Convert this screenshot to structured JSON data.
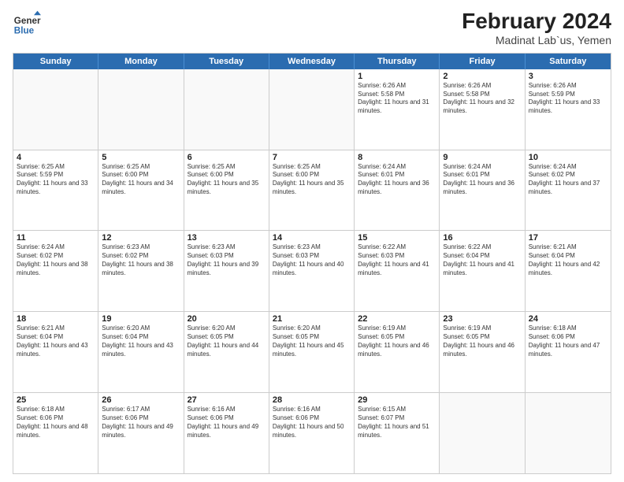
{
  "header": {
    "logo": {
      "line1": "General",
      "line2": "Blue"
    },
    "title": "February 2024",
    "subtitle": "Madinat Lab`us, Yemen"
  },
  "weekdays": [
    "Sunday",
    "Monday",
    "Tuesday",
    "Wednesday",
    "Thursday",
    "Friday",
    "Saturday"
  ],
  "rows": [
    [
      {
        "day": "",
        "empty": true
      },
      {
        "day": "",
        "empty": true
      },
      {
        "day": "",
        "empty": true
      },
      {
        "day": "",
        "empty": true
      },
      {
        "day": "1",
        "sunrise": "6:26 AM",
        "sunset": "5:58 PM",
        "daylight": "11 hours and 31 minutes."
      },
      {
        "day": "2",
        "sunrise": "6:26 AM",
        "sunset": "5:58 PM",
        "daylight": "11 hours and 32 minutes."
      },
      {
        "day": "3",
        "sunrise": "6:26 AM",
        "sunset": "5:59 PM",
        "daylight": "11 hours and 33 minutes."
      }
    ],
    [
      {
        "day": "4",
        "sunrise": "6:25 AM",
        "sunset": "5:59 PM",
        "daylight": "11 hours and 33 minutes."
      },
      {
        "day": "5",
        "sunrise": "6:25 AM",
        "sunset": "6:00 PM",
        "daylight": "11 hours and 34 minutes."
      },
      {
        "day": "6",
        "sunrise": "6:25 AM",
        "sunset": "6:00 PM",
        "daylight": "11 hours and 35 minutes."
      },
      {
        "day": "7",
        "sunrise": "6:25 AM",
        "sunset": "6:00 PM",
        "daylight": "11 hours and 35 minutes."
      },
      {
        "day": "8",
        "sunrise": "6:24 AM",
        "sunset": "6:01 PM",
        "daylight": "11 hours and 36 minutes."
      },
      {
        "day": "9",
        "sunrise": "6:24 AM",
        "sunset": "6:01 PM",
        "daylight": "11 hours and 36 minutes."
      },
      {
        "day": "10",
        "sunrise": "6:24 AM",
        "sunset": "6:02 PM",
        "daylight": "11 hours and 37 minutes."
      }
    ],
    [
      {
        "day": "11",
        "sunrise": "6:24 AM",
        "sunset": "6:02 PM",
        "daylight": "11 hours and 38 minutes."
      },
      {
        "day": "12",
        "sunrise": "6:23 AM",
        "sunset": "6:02 PM",
        "daylight": "11 hours and 38 minutes."
      },
      {
        "day": "13",
        "sunrise": "6:23 AM",
        "sunset": "6:03 PM",
        "daylight": "11 hours and 39 minutes."
      },
      {
        "day": "14",
        "sunrise": "6:23 AM",
        "sunset": "6:03 PM",
        "daylight": "11 hours and 40 minutes."
      },
      {
        "day": "15",
        "sunrise": "6:22 AM",
        "sunset": "6:03 PM",
        "daylight": "11 hours and 41 minutes."
      },
      {
        "day": "16",
        "sunrise": "6:22 AM",
        "sunset": "6:04 PM",
        "daylight": "11 hours and 41 minutes."
      },
      {
        "day": "17",
        "sunrise": "6:21 AM",
        "sunset": "6:04 PM",
        "daylight": "11 hours and 42 minutes."
      }
    ],
    [
      {
        "day": "18",
        "sunrise": "6:21 AM",
        "sunset": "6:04 PM",
        "daylight": "11 hours and 43 minutes."
      },
      {
        "day": "19",
        "sunrise": "6:20 AM",
        "sunset": "6:04 PM",
        "daylight": "11 hours and 43 minutes."
      },
      {
        "day": "20",
        "sunrise": "6:20 AM",
        "sunset": "6:05 PM",
        "daylight": "11 hours and 44 minutes."
      },
      {
        "day": "21",
        "sunrise": "6:20 AM",
        "sunset": "6:05 PM",
        "daylight": "11 hours and 45 minutes."
      },
      {
        "day": "22",
        "sunrise": "6:19 AM",
        "sunset": "6:05 PM",
        "daylight": "11 hours and 46 minutes."
      },
      {
        "day": "23",
        "sunrise": "6:19 AM",
        "sunset": "6:05 PM",
        "daylight": "11 hours and 46 minutes."
      },
      {
        "day": "24",
        "sunrise": "6:18 AM",
        "sunset": "6:06 PM",
        "daylight": "11 hours and 47 minutes."
      }
    ],
    [
      {
        "day": "25",
        "sunrise": "6:18 AM",
        "sunset": "6:06 PM",
        "daylight": "11 hours and 48 minutes."
      },
      {
        "day": "26",
        "sunrise": "6:17 AM",
        "sunset": "6:06 PM",
        "daylight": "11 hours and 49 minutes."
      },
      {
        "day": "27",
        "sunrise": "6:16 AM",
        "sunset": "6:06 PM",
        "daylight": "11 hours and 49 minutes."
      },
      {
        "day": "28",
        "sunrise": "6:16 AM",
        "sunset": "6:06 PM",
        "daylight": "11 hours and 50 minutes."
      },
      {
        "day": "29",
        "sunrise": "6:15 AM",
        "sunset": "6:07 PM",
        "daylight": "11 hours and 51 minutes."
      },
      {
        "day": "",
        "empty": true
      },
      {
        "day": "",
        "empty": true
      }
    ]
  ]
}
